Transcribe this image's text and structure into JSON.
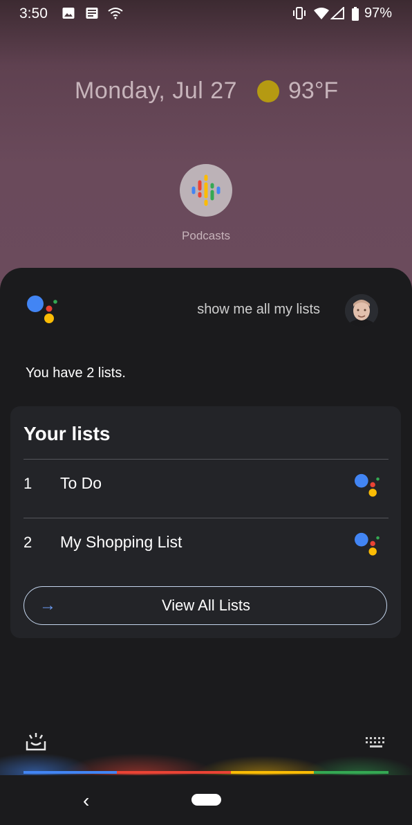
{
  "status_bar": {
    "time": "3:50",
    "battery_percent": "97%",
    "left_icons": [
      "image-icon",
      "news-icon",
      "wifi-icon"
    ],
    "right_icons": [
      "vibrate-icon",
      "wifi-icon",
      "cell-signal-icon",
      "battery-icon"
    ]
  },
  "home": {
    "date": "Monday, Jul 27",
    "weather_icon": "sun-icon",
    "temperature": "93°F",
    "app_label": "Podcasts"
  },
  "assistant": {
    "query": "show me all my lists",
    "answer": "You have 2 lists.",
    "card": {
      "title": "Your lists",
      "items": [
        {
          "number": "1",
          "label": "To Do"
        },
        {
          "number": "2",
          "label": "My Shopping List"
        }
      ],
      "view_all_label": "View All Lists"
    }
  },
  "colors": {
    "google_blue": "#4285F4",
    "google_red": "#EA4335",
    "google_yellow": "#FBBC05",
    "google_green": "#34A853",
    "sheet_bg": "#1b1b1d",
    "card_bg": "#232428"
  }
}
